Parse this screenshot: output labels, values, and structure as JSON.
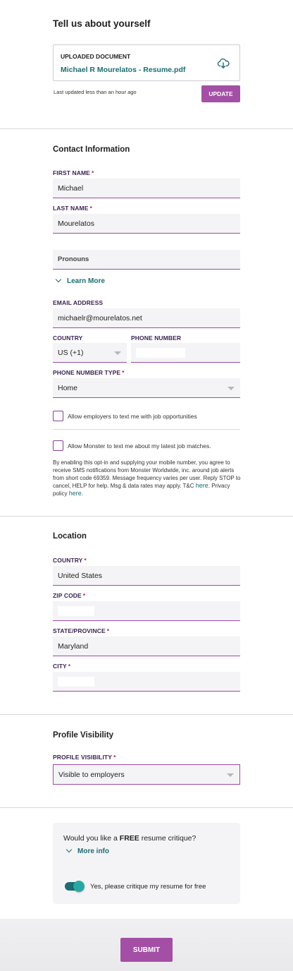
{
  "resume": {
    "title": "Tell us about yourself",
    "uploaded_label": "UPLOADED DOCUMENT",
    "file_name": "Michael R Mourelatos - Resume.pdf",
    "last_updated": "Last updated less than an hour ago",
    "update_button": "UPDATE"
  },
  "contact": {
    "title": "Contact Information",
    "first_name_label": "FIRST NAME",
    "first_name_value": "Michael",
    "last_name_label": "LAST NAME",
    "last_name_value": "Mourelatos",
    "pronouns_placeholder": "Pronouns",
    "learn_more": "Learn More",
    "email_label": "EMAIL ADDRESS",
    "email_value": "michaelr@mourelatos.net",
    "country_label": "COUNTRY",
    "country_value": "US (+1)",
    "phone_label": "PHONE NUMBER",
    "phone_type_label": "PHONE NUMBER TYPE",
    "phone_type_value": "Home",
    "text_jobs": "Allow employers to text me with job opportunities",
    "text_monster": "Allow Monster to text me about my latest job matches.",
    "disclaimer": "By enabling this opt-in and supplying your mobile number, you agree to receive SMS notifications from Monster Worldwide, inc. around job alerts from short code 69359. Message frequency varies per user. Reply STOP to cancel, HELP for help. Msg & data rates may apply. T&C",
    "here1": "here",
    "privacy": ". Privacy policy",
    "here2": "here",
    "period": "."
  },
  "location": {
    "title": "Location",
    "country_label": "COUNTRY",
    "country_value": "United States",
    "zip_label": "ZIP CODE",
    "state_label": "STATE/PROVINCE",
    "state_value": "Maryland",
    "city_label": "CITY"
  },
  "visibility": {
    "title": "Profile Visibility",
    "label": "PROFILE VISIBILITY",
    "value": "Visible to employers"
  },
  "critique": {
    "question_pre": "Would you like a",
    "question_bold": "FREE",
    "question_post": "resume critique?",
    "more_info": "More info",
    "toggle_label": "Yes, please critique my resume for free",
    "toggle_on": true
  },
  "footer": {
    "submit": "SUBMIT"
  },
  "colors": {
    "accent": "#a34fa6",
    "link": "#1b6c74",
    "field_bg": "#f4f3f5"
  }
}
